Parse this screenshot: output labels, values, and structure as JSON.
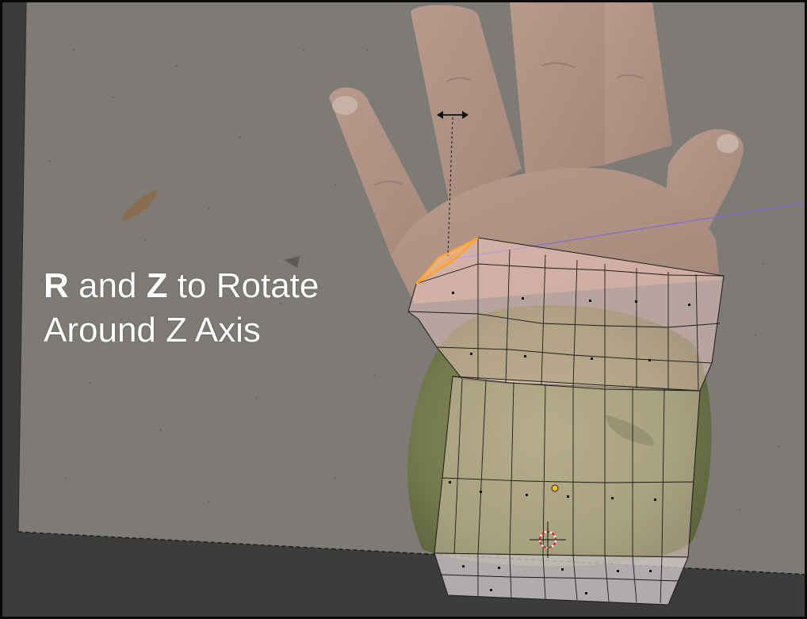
{
  "viewport": {
    "name": "3D Viewport (Edit Mode)",
    "background_color": "#3c3c3c",
    "reference_image_tint": "#7e7a75"
  },
  "instruction": {
    "key1": "R",
    "and_word": "and",
    "key2": "Z",
    "line1_rest": "to Rotate",
    "line2": "Around Z Axis"
  },
  "mesh": {
    "face_fill": "#ffd8d0",
    "selection_color": "#ffa030",
    "edge_color": "#1a1a1a",
    "vertex_color": "#111111",
    "origin_color": "#f0c020",
    "axis_line_color": "#8070d0"
  },
  "icons": {
    "transform_cursor": "horizontal-double-arrow-icon",
    "cursor_3d": "3d-cursor-icon",
    "object_origin": "origin-dot-icon"
  }
}
